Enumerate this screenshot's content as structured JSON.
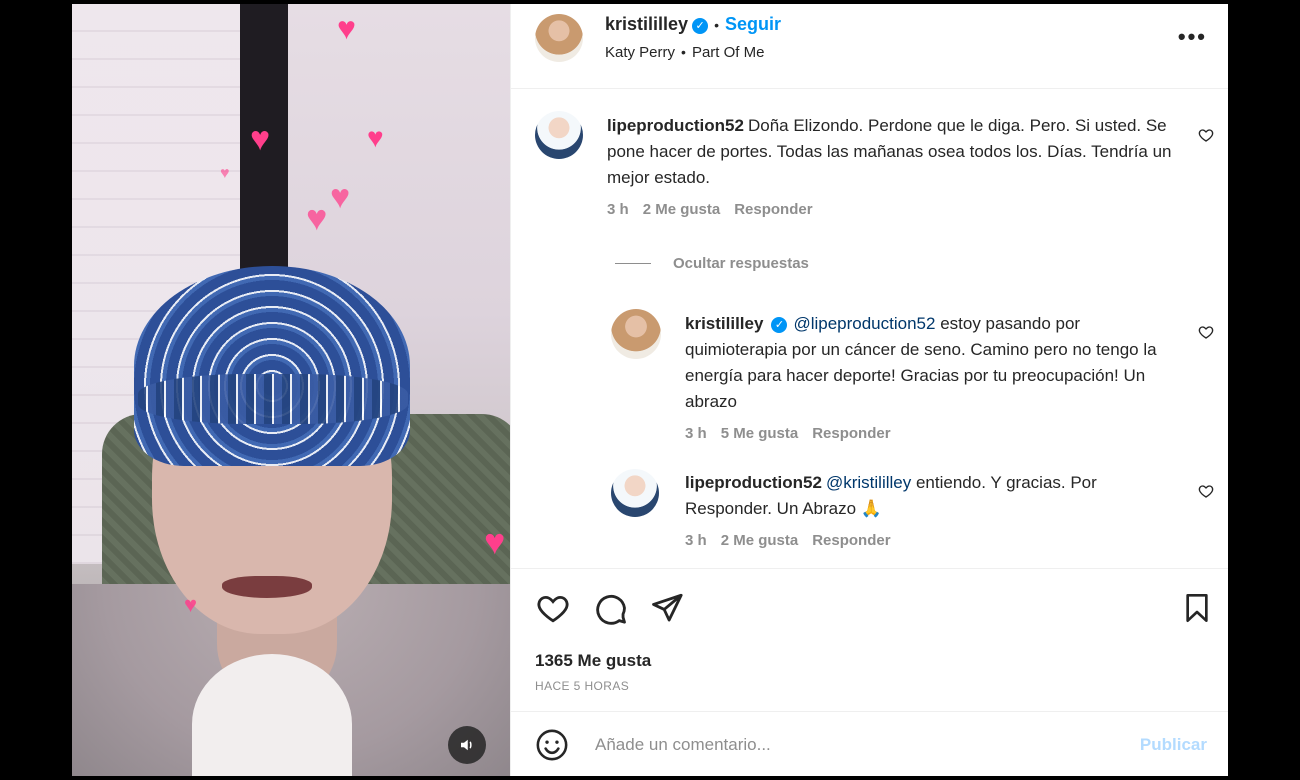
{
  "post": {
    "author": "kristililley",
    "follow_label": "Seguir",
    "separator": "•",
    "audio_artist": "Katy Perry",
    "audio_title": "Part Of Me",
    "more_label": "•••"
  },
  "comments": [
    {
      "username": "lipeproduction52",
      "text": "Doña Elizondo. Perdone que le diga. Pero. Si usted. Se pone hacer de portes. Todas las mañanas osea todos los. Días. Tendría un mejor estado.",
      "time": "3 h",
      "likes": "2 Me gusta",
      "reply_label": "Responder"
    }
  ],
  "hide_replies_label": "Ocultar respuestas",
  "replies": [
    {
      "username": "kristililley",
      "mention": "@lipeproduction52",
      "text": "estoy pasando por quimioterapia por un cáncer de seno. Camino pero no tengo la energía para hacer deporte! Gracias por tu preocupación! Un abrazo",
      "time": "3 h",
      "likes": "5 Me gusta",
      "reply_label": "Responder"
    },
    {
      "username": "lipeproduction52",
      "mention": "@kristililley",
      "text": "entiendo. Y gracias. Por Responder. Un Abrazo 🙏",
      "time": "3 h",
      "likes": "2 Me gusta",
      "reply_label": "Responder"
    }
  ],
  "stats": {
    "likes": "1365 Me gusta",
    "posted": "HACE 5 HORAS"
  },
  "composer": {
    "placeholder": "Añade un comentario...",
    "publish_label": "Publicar"
  },
  "colors": {
    "accent": "#0095f6",
    "text": "#262626",
    "muted": "#8e8e8e",
    "publish_disabled": "#b3dbff",
    "hearts": "#ff3f8c"
  },
  "icons": [
    "verified-badge-icon",
    "more-options-icon",
    "heart-icon",
    "comment-icon",
    "share-icon",
    "bookmark-icon",
    "emoji-icon",
    "sound-icon"
  ]
}
